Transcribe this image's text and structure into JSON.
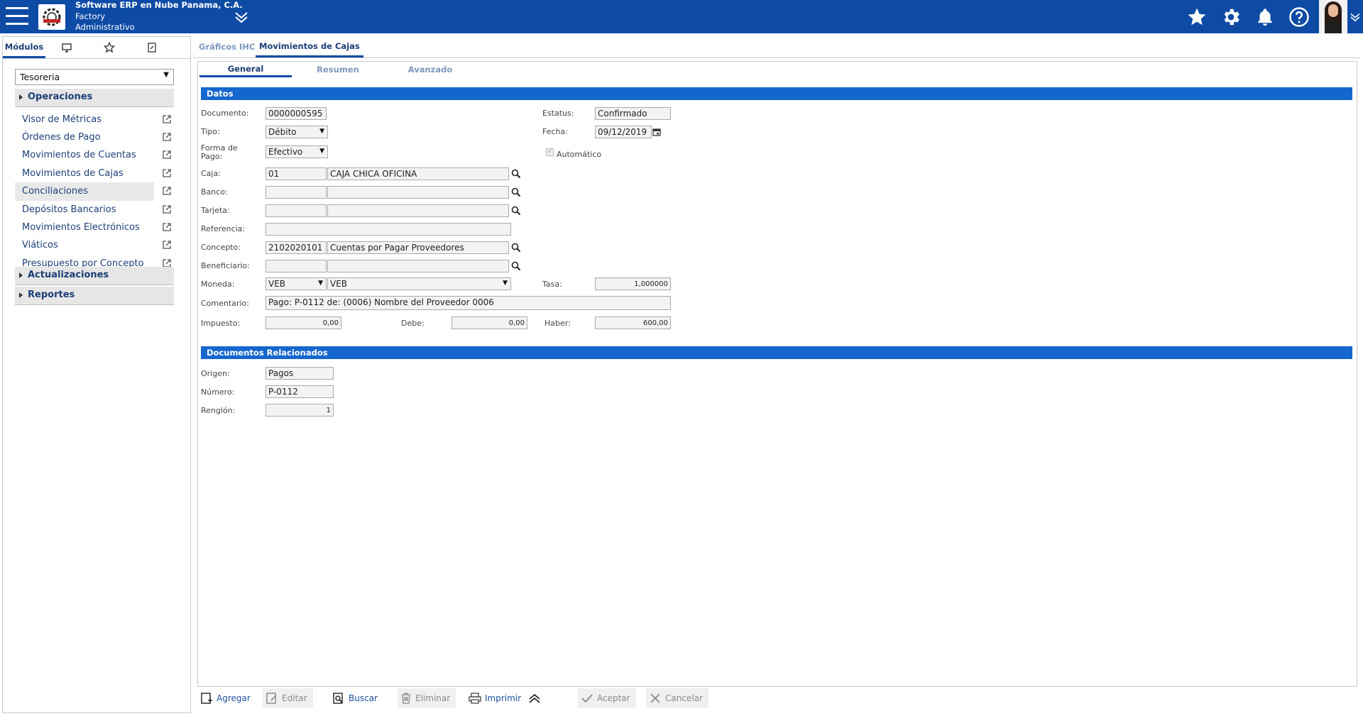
{
  "header": {
    "company": "Software ERP en Nube Panama, C.A.",
    "line2": "Factory",
    "line3": "Administrativo"
  },
  "left_panel": {
    "tabs": [
      {
        "label": "Módulos",
        "icon": "modules"
      },
      {
        "label": "",
        "icon": "monitor-icon"
      },
      {
        "label": "",
        "icon": "star-icon"
      },
      {
        "label": "",
        "icon": "document-icon"
      }
    ],
    "module_selected": "Tesoreria",
    "groups": {
      "operaciones": "Operaciones",
      "actualizaciones": "Actualizaciones",
      "reportes": "Reportes"
    },
    "items": [
      "Visor de Métricas",
      "Órdenes de Pago",
      "Movimientos de Cuentas",
      "Movimientos de Cajas",
      "Conciliaciones",
      "Depósitos Bancarios",
      "Movimientos Electrónicos",
      "Viáticos",
      "Presupuesto por Concepto"
    ],
    "selected_item": "Conciliaciones"
  },
  "tabs": {
    "graficos": "Gráficos IHC",
    "movimientos": "Movimientos de Cajas"
  },
  "subtabs": {
    "general": "General",
    "resumen": "Resumen",
    "avanzado": "Avanzado"
  },
  "datos": {
    "section_title": "Datos",
    "documento_label": "Documento:",
    "documento": "0000000595",
    "estatus_label": "Estatus:",
    "estatus": "Confirmado",
    "tipo_label": "Tipo:",
    "tipo": "Débito",
    "fecha_label": "Fecha:",
    "fecha": "09/12/2019",
    "forma_label_1": "Forma de",
    "forma_label_2": "Pago:",
    "forma": "Efectivo",
    "automatico_label": "Automático",
    "automatico_checked": true,
    "caja_label": "Caja:",
    "caja_code": "01",
    "caja_name": "CAJA CHICA OFICINA",
    "banco_label": "Banco:",
    "banco_code": "",
    "banco_name": "",
    "tarjeta_label": "Tarjeta:",
    "tarjeta_code": "",
    "tarjeta_name": "",
    "referencia_label": "Referencia:",
    "referencia": "",
    "concepto_label": "Concepto:",
    "concepto_code": "2102020101",
    "concepto_name": "Cuentas por Pagar Proveedores",
    "beneficiario_label": "Beneficiario:",
    "beneficiario_code": "",
    "beneficiario_name": "",
    "moneda_label": "Moneda:",
    "moneda_code": "VEB",
    "moneda_name": "VEB",
    "tasa_label": "Tasa:",
    "tasa": "1,000000",
    "comentario_label": "Comentario:",
    "comentario": "Pago: P-0112 de: (0006) Nombre del Proveedor 0006",
    "impuesto_label": "Impuesto:",
    "impuesto": "0,00",
    "debe_label": "Debe:",
    "debe": "0,00",
    "haber_label": "Haber:",
    "haber": "600,00"
  },
  "relacionados": {
    "section_title": "Documentos Relacionados",
    "origen_label": "Origen:",
    "origen": "Pagos",
    "numero_label": "Número:",
    "numero": "P-0112",
    "renglon_label": "Renglón:",
    "renglon": "1"
  },
  "toolbar": {
    "agregar": "Agregar",
    "editar": "Editar",
    "buscar": "Buscar",
    "eliminar": "Eliminar",
    "imprimir": "Imprimir",
    "aceptar": "Aceptar",
    "cancelar": "Cancelar"
  },
  "colors": {
    "topbar": "#0d4ba5",
    "section": "#1667cd",
    "link": "#1c3f77"
  }
}
